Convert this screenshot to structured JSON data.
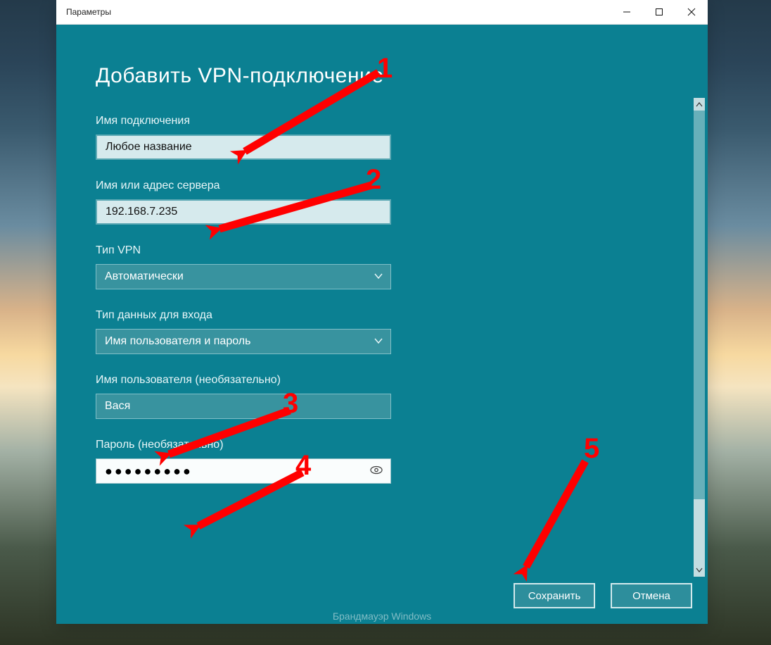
{
  "window": {
    "title": "Параметры"
  },
  "page": {
    "heading": "Добавить VPN-подключение"
  },
  "fields": {
    "connection_name": {
      "label": "Имя подключения",
      "value": "Любое название"
    },
    "server": {
      "label": "Имя или адрес сервера",
      "value": "192.168.7.235"
    },
    "vpn_type": {
      "label": "Тип VPN",
      "value": "Автоматически"
    },
    "signin_type": {
      "label": "Тип данных для входа",
      "value": "Имя пользователя и пароль"
    },
    "username": {
      "label": "Имя пользователя (необязательно)",
      "value": "Вася"
    },
    "password": {
      "label": "Пароль (необязательно)",
      "value": "●●●●●●●●●"
    }
  },
  "buttons": {
    "save": "Сохранить",
    "cancel": "Отмена"
  },
  "annotations": {
    "a1": "1",
    "a2": "2",
    "a3": "3",
    "a4": "4",
    "a5": "5"
  },
  "footer_hint": "Брандмауэр Windows",
  "colors": {
    "panel": "#0b8092",
    "accent_red": "#ff0000"
  }
}
